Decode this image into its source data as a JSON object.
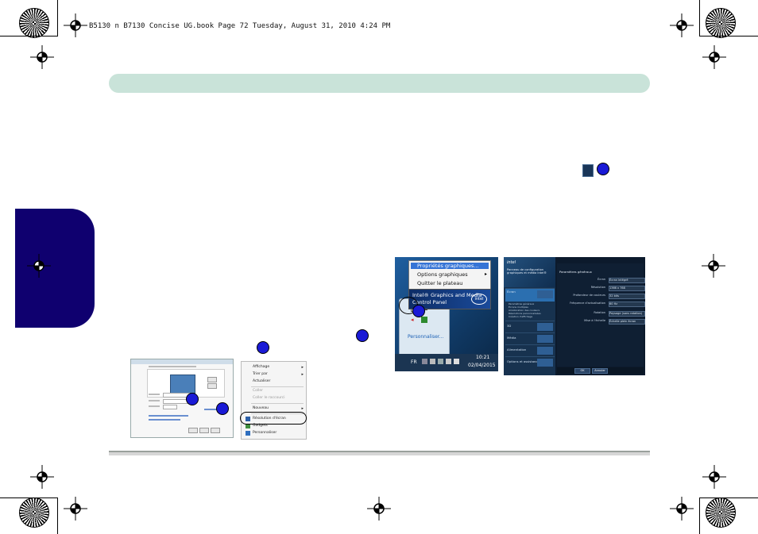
{
  "header": {
    "running_head": "B5130 n B7130 Concise UG.book  Page 72  Tuesday, August 31, 2010  4:24 PM"
  },
  "context_menu": {
    "items": [
      {
        "label": "Affichage",
        "arrow": true,
        "disabled": false
      },
      {
        "label": "Trier par",
        "arrow": true,
        "disabled": false
      },
      {
        "label": "Actualiser",
        "arrow": false,
        "disabled": false
      },
      {
        "label": "Coller",
        "arrow": false,
        "disabled": true
      },
      {
        "label": "Coller le raccourci",
        "arrow": false,
        "disabled": true
      },
      {
        "label": "Nouveau",
        "arrow": true,
        "disabled": false
      },
      {
        "label": "Résolution d'écran",
        "arrow": false,
        "disabled": false
      },
      {
        "label": "Gadgets",
        "arrow": false,
        "disabled": false
      },
      {
        "label": "Personnaliser",
        "arrow": false,
        "disabled": false
      }
    ]
  },
  "tray_menu": {
    "items": [
      "Propriétés graphiques...",
      "Options graphiques",
      "Quitter le plateau"
    ],
    "banner_line1": "Intel® Graphics and Media",
    "banner_line2": "Control Panel",
    "banner_logo": "intel",
    "customize_link": "Personnaliser...",
    "lang": "FR",
    "time": "10:21",
    "date": "02/04/2015"
  },
  "intel_panel": {
    "header_logo": "intel",
    "header_title": "Panneau de configuration graphiques et média Intel®",
    "section_title": "Paramètres généraux",
    "nav": [
      {
        "label": "Écran"
      },
      {
        "label": "3D"
      },
      {
        "label": "Média"
      },
      {
        "label": "Alimentation"
      },
      {
        "label": "Options et assistance"
      }
    ],
    "subnav": [
      "Paramètres généraux",
      "Écrans multiples",
      "Amélioration des couleurs",
      "Résolutions personnalisées",
      "Création d'affichage"
    ],
    "rows": [
      {
        "label": "Écran",
        "value": "Écran intégré"
      },
      {
        "label": "Résolution",
        "value": "1366 x 768"
      },
      {
        "label": "Profondeur de couleurs",
        "value": "32 bits"
      },
      {
        "label": "Fréquence d'actualisation",
        "value": "60 Hz"
      },
      {
        "label": "Rotation",
        "value": "Paysage (sans rotation)"
      },
      {
        "label": "Mise à l'échelle",
        "value": "Échelle plein écran"
      }
    ],
    "ok": "OK",
    "cancel": "Annuler"
  },
  "colors": {
    "banner": "#c9e3d9",
    "side_tab": "#0f006f",
    "callout": "#1a1ad6",
    "footer_rule": "#9aa09c"
  }
}
